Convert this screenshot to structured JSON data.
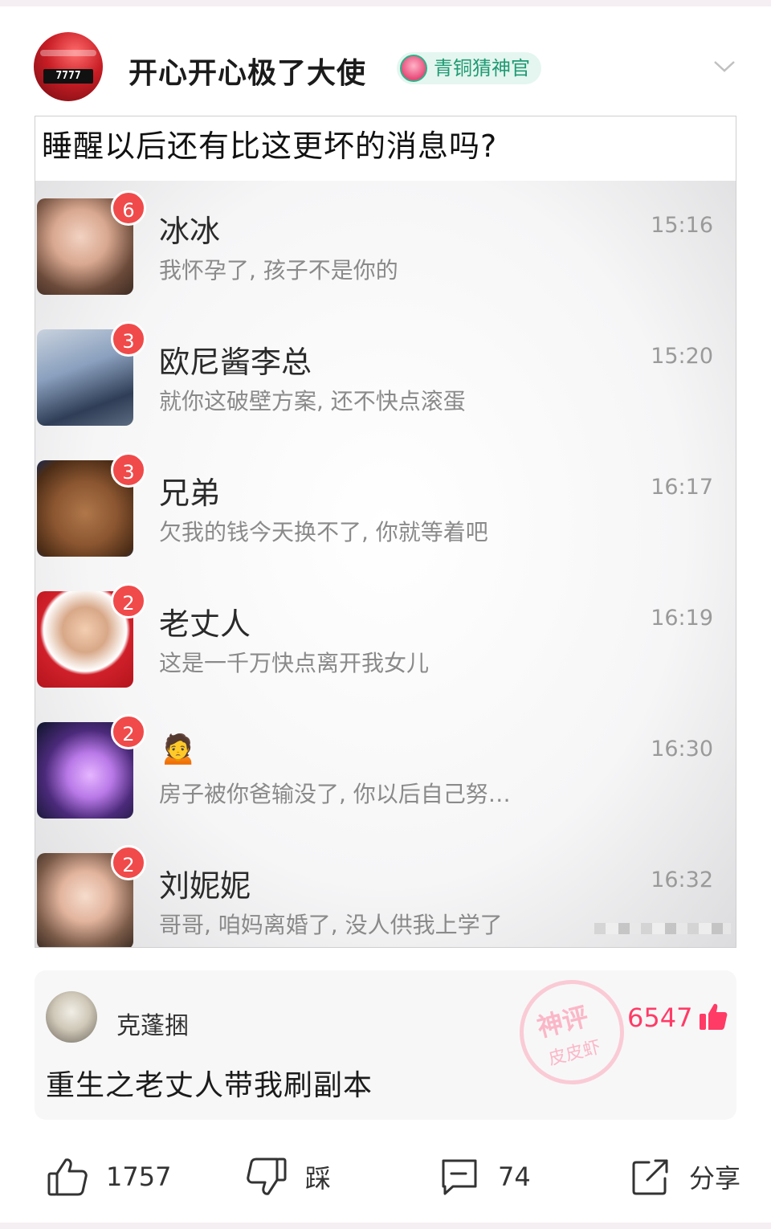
{
  "header": {
    "username": "开心开心极了大使",
    "badge_label": "青铜猜神官",
    "avatar_plate": "7777"
  },
  "post": {
    "image_title": "睡醒以后还有比这更坏的消息吗?",
    "chats": [
      {
        "name": "冰冰",
        "time": "15:16",
        "message": "我怀孕了, 孩子不是你的",
        "unread": "6"
      },
      {
        "name": "欧尼酱李总",
        "time": "15:20",
        "message": "就你这破壁方案, 还不快点滚蛋",
        "unread": "3"
      },
      {
        "name": "兄弟",
        "time": "16:17",
        "message": "欠我的钱今天换不了, 你就等着吧",
        "unread": "3"
      },
      {
        "name": "老丈人",
        "time": "16:19",
        "message": "这是一千万快点离开我女儿",
        "unread": "2"
      },
      {
        "name": "🙍",
        "time": "16:30",
        "message": "房子被你爸输没了, 你以后自己努…",
        "unread": "2"
      },
      {
        "name": "刘妮妮",
        "time": "16:32",
        "message": "哥哥, 咱妈离婚了, 没人供我上学了",
        "unread": "2"
      }
    ]
  },
  "comment": {
    "author": "克蓬捆",
    "text": "重生之老丈人带我刷副本",
    "likes": "6547",
    "stamp_top": "神评",
    "stamp_bottom": "皮皮虾"
  },
  "actions": {
    "like_count": "1757",
    "dislike_label": "踩",
    "comment_count": "74",
    "share_label": "分享"
  },
  "colors": {
    "accent": "#ff3b66",
    "badge_bg": "#e4f6ef",
    "badge_text": "#1f9a73",
    "unread_badge": "#f04a4a"
  },
  "icons": {
    "more": "chevron-down-icon",
    "like": "thumbs-up-icon",
    "dislike": "thumbs-down-icon",
    "comment": "comment-icon",
    "share": "share-icon"
  }
}
